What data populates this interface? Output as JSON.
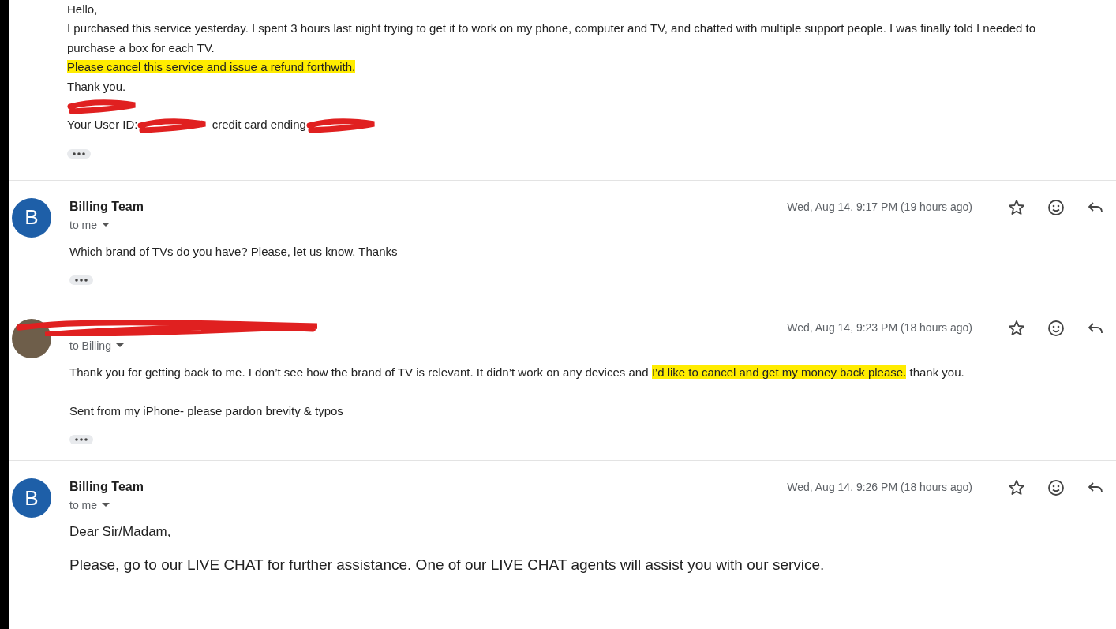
{
  "messages": [
    {
      "paragraphs": [
        [
          {
            "kind": "text",
            "text": "Hello,",
            "highlighted": false
          }
        ],
        [
          {
            "kind": "text",
            "text": "I purchased this service yesterday. I spent 3 hours last night trying to get it to work on my phone, computer and TV, and chatted with multiple support people. I was finally told I needed to",
            "highlighted": false
          }
        ],
        [
          {
            "kind": "text",
            "text": "purchase a box for each TV.",
            "highlighted": false
          }
        ],
        [
          {
            "kind": "text",
            "text": "Please cancel this service and issue a refund forthwith.",
            "highlighted": true
          }
        ],
        [
          {
            "kind": "text",
            "text": "Thank you.",
            "highlighted": false
          }
        ],
        [
          {
            "kind": "redaction"
          }
        ],
        [
          {
            "kind": "text",
            "text": "Your User ID:",
            "highlighted": false
          },
          {
            "kind": "redaction"
          },
          {
            "kind": "text",
            "text": " credit card ending",
            "highlighted": false
          },
          {
            "kind": "redaction"
          }
        ]
      ]
    },
    {
      "sender": "Billing Team",
      "sender_redacted": false,
      "avatar": {
        "kind": "letter",
        "letter": "B"
      },
      "recipient": "to me",
      "date": "Wed, Aug 14, 9:17 PM (19 hours ago)",
      "paragraphs": [
        [
          {
            "kind": "text",
            "text": "Which brand of TVs do you have? Please, let us know. Thanks",
            "highlighted": false
          }
        ]
      ]
    },
    {
      "sender_redacted": true,
      "avatar": {
        "kind": "photo"
      },
      "recipient": "to Billing",
      "date": "Wed, Aug 14, 9:23 PM (18 hours ago)",
      "paragraphs": [
        [
          {
            "kind": "text",
            "text": "Thank you for getting back to me. I don’t see how the brand of TV is relevant. It didn’t work on any devices and ",
            "highlighted": false
          },
          {
            "kind": "text",
            "text": "I’d like to cancel and get my money back please.",
            "highlighted": true
          },
          {
            "kind": "text",
            "text": " thank you.",
            "highlighted": false
          }
        ],
        [
          {
            "kind": "text",
            "text": "Sent from my iPhone- please pardon brevity & typos",
            "highlighted": false
          }
        ]
      ]
    },
    {
      "sender": "Billing Team",
      "sender_redacted": false,
      "avatar": {
        "kind": "letter",
        "letter": "B"
      },
      "recipient": "to me",
      "date": "Wed, Aug 14, 9:26 PM (18 hours ago)",
      "paragraphs": [
        [
          {
            "kind": "text",
            "text": "Dear Sir/Madam,",
            "highlighted": false
          }
        ],
        [
          {
            "kind": "text",
            "text": "Please, go to our LIVE CHAT for further assistance. One of our LIVE CHAT agents will assist you with our service.",
            "highlighted": false
          }
        ]
      ]
    }
  ]
}
